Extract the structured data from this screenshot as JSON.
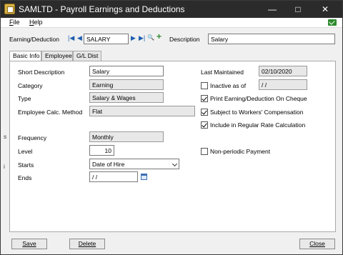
{
  "window": {
    "title": "SAMLTD - Payroll Earnings and Deductions"
  },
  "titlebar_buttons": {
    "minimize": "—",
    "maximize": "□",
    "close": "✕"
  },
  "menu": {
    "file": "F",
    "file_rest": "ile",
    "help": "H",
    "help_rest": "elp"
  },
  "header": {
    "earning_label": "Earning/Deduction",
    "earning_value": "SALARY",
    "description_label": "Description",
    "description_value": "Salary"
  },
  "nav_glyphs": {
    "first": "|◀",
    "prev": "◀",
    "next": "▶",
    "last": "▶|",
    "finder": "🔍",
    "new": "+"
  },
  "tabs": [
    {
      "label": "Basic Info",
      "active": true
    },
    {
      "label": "Employee",
      "active": false
    },
    {
      "label": "G/L Dist",
      "active": false
    }
  ],
  "basic": {
    "short_desc_label": "Short Description",
    "short_desc_value": "Salary",
    "category_label": "Category",
    "category_value": "Earning",
    "type_label": "Type",
    "type_value": "Salary & Wages",
    "calc_label": "Employee Calc. Method",
    "calc_value": "Flat",
    "frequency_label": "Frequency",
    "frequency_value": "Monthly",
    "level_label": "Level",
    "level_value": "10",
    "starts_label": "Starts",
    "starts_value": "Date of Hire",
    "ends_label": "Ends",
    "ends_value": "/ /"
  },
  "right": {
    "last_maintained_label": "Last Maintained",
    "last_maintained_value": "02/10/2020",
    "inactive_label": "Inactive as of",
    "inactive_value": "/ /",
    "print_label": "Print Earning/Deduction On Cheque",
    "workers_label": "Subject to Workers' Compensation",
    "regular_label": "Include in Regular Rate Calculation",
    "nonperiodic_label": "Non-periodic Payment"
  },
  "checkboxes": {
    "inactive": false,
    "print": true,
    "workers": true,
    "regular": true,
    "nonperiodic": false
  },
  "left_edge_marks": [
    "s",
    "i"
  ],
  "footer": {
    "save": "Save",
    "delete": "Delete",
    "close": "Close"
  },
  "colors": {
    "titlebar": "#2b2b2b",
    "accent_green": "#2e8b2e",
    "nav_blue": "#1f5fb0"
  }
}
